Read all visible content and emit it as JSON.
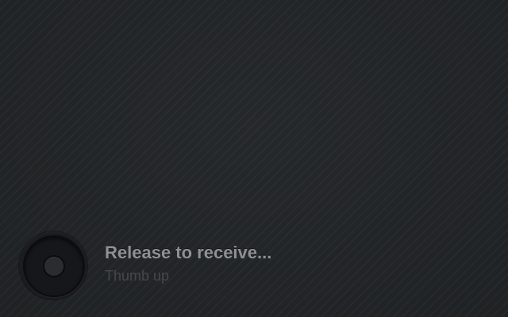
{
  "prompt": {
    "headline": "Release to receive...",
    "subline": "Thumb up"
  },
  "knob": {
    "icon": "drag-handle-icon"
  },
  "colors": {
    "background": "#222527",
    "headline": "#8e9093",
    "subline": "#45484b"
  }
}
